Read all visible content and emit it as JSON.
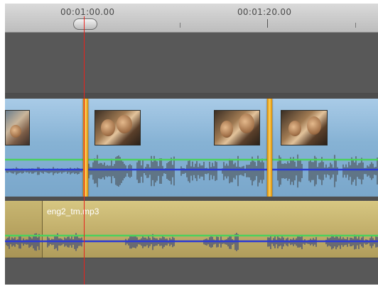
{
  "ruler": {
    "timecodes": [
      "00:01:00.00",
      "00:01:20.00"
    ]
  },
  "tracks": {
    "audio": {
      "clip_name": "eng2_tm.mp3"
    }
  },
  "colors": {
    "playhead": "#e8231d",
    "video_track": "#8ab6d8",
    "audio_track": "#c3b06c",
    "edit_handle": "#ffc72c",
    "volume_line": "#2a3ad6",
    "pan_line": "#4cd05c"
  },
  "icons": {
    "scrub_handle": "playhead-scrub-handle-icon"
  }
}
